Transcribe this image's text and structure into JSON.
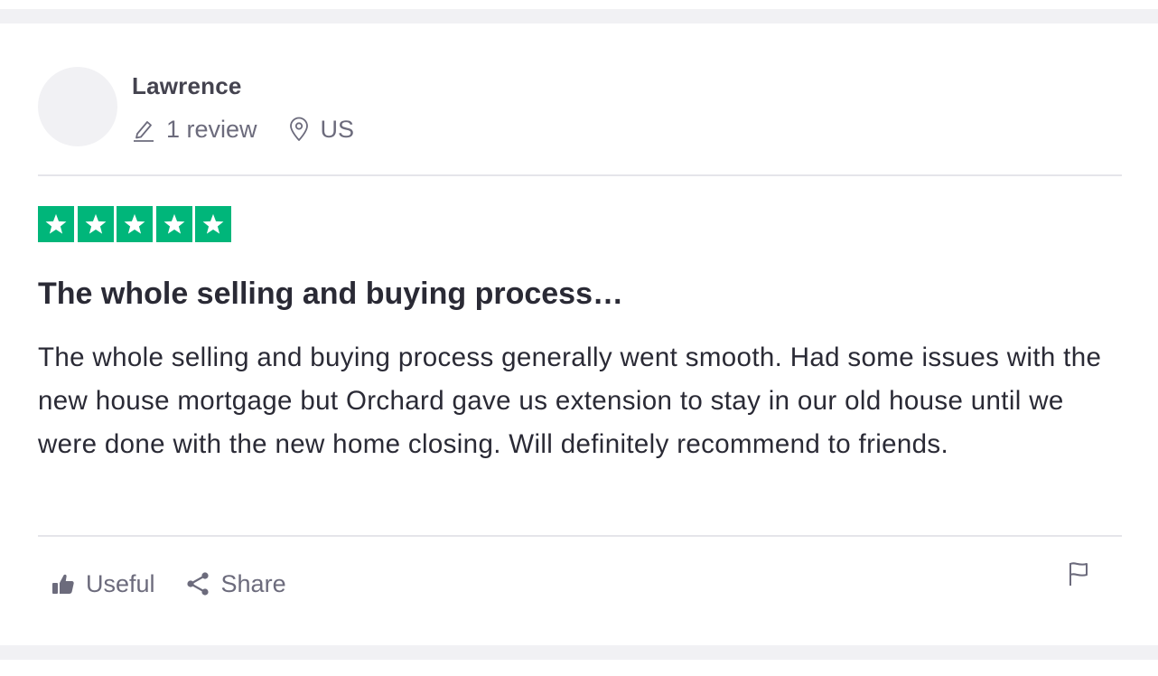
{
  "consumer": {
    "name": "Lawrence",
    "reviews_count_label": "1 review",
    "location": "US"
  },
  "review": {
    "rating": 5,
    "rating_max": 5,
    "title": "The whole selling and buying process…",
    "text": "The whole selling and buying process generally went smooth. Had some issues with the new house mortgage but Orchard gave us extension to stay in our old house until we were done with the new home closing. Will definitely recommend to friends."
  },
  "actions": {
    "useful_label": "Useful",
    "share_label": "Share"
  },
  "colors": {
    "star_green": "#00b67a",
    "muted_text": "#6c6b7c",
    "divider": "#e5e5ea"
  },
  "icons": {
    "review_count": "pencil-icon",
    "location": "map-pin-icon",
    "useful": "thumbs-up-icon",
    "share": "share-icon",
    "report": "flag-icon"
  }
}
